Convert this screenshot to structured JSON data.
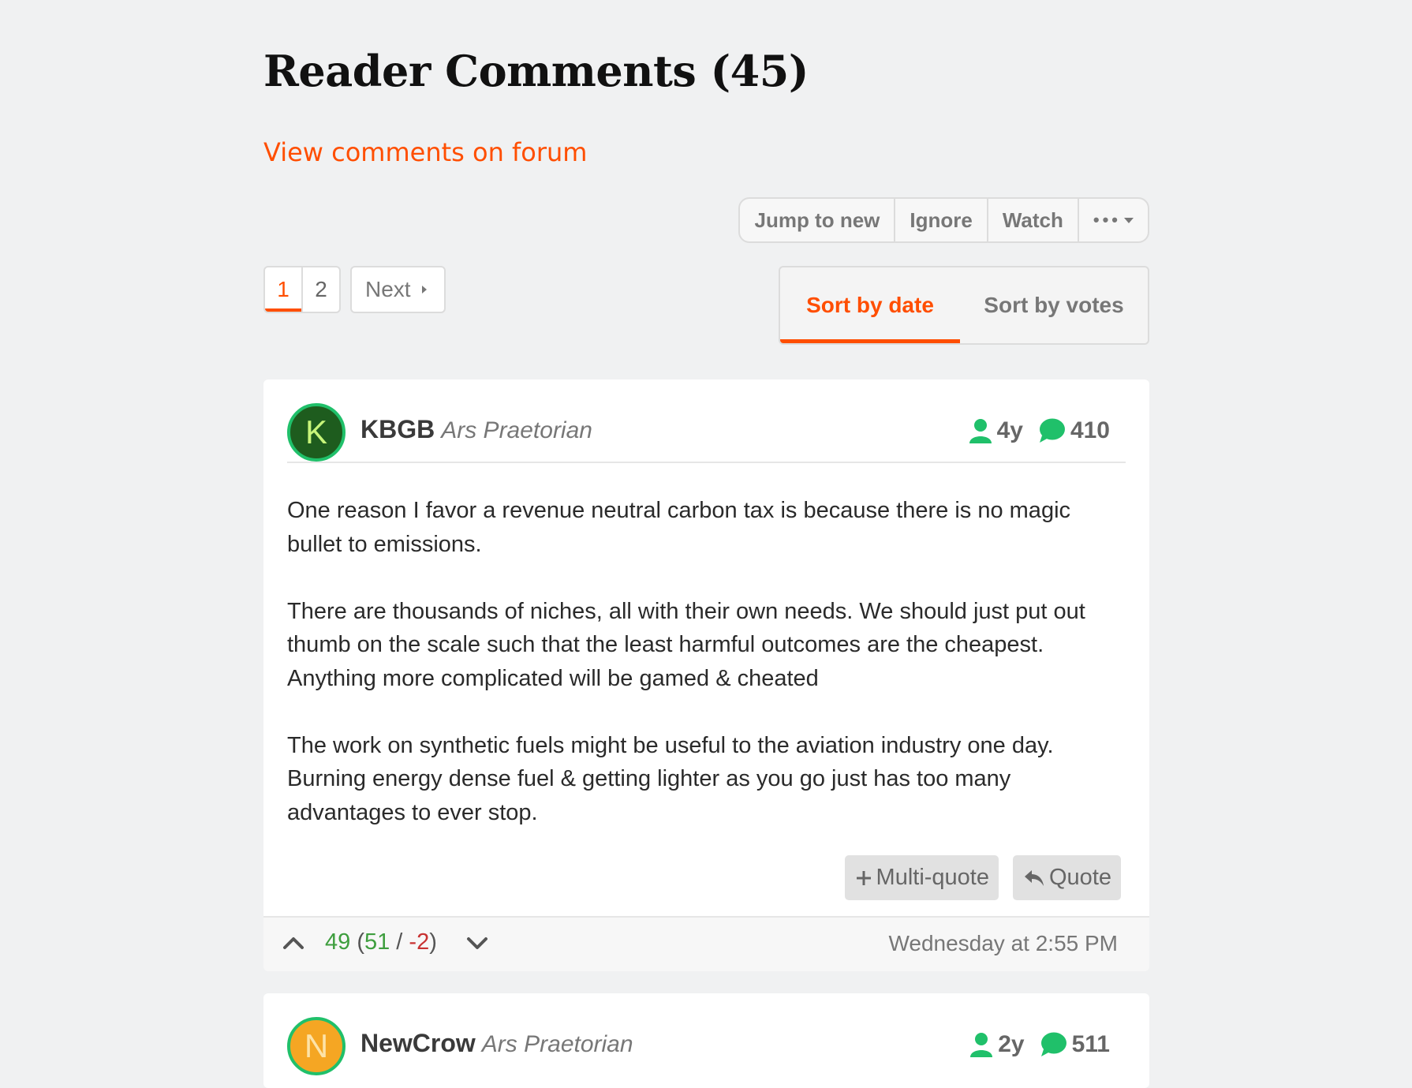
{
  "header": {
    "title": "Reader Comments (45)",
    "forum_link": "View comments on forum"
  },
  "thread_actions": {
    "jump_to_new": "Jump to new",
    "ignore": "Ignore",
    "watch": "Watch",
    "more": "•••"
  },
  "pagination": {
    "pages": [
      "1",
      "2"
    ],
    "current": "1",
    "next_label": "Next"
  },
  "sort": {
    "by_date": "Sort by date",
    "by_votes": "Sort by votes",
    "active": "Sort by date"
  },
  "colors": {
    "accent": "#ff4e00",
    "online_green": "#20c06a",
    "positive": "#3e9e3e",
    "negative": "#c83232"
  },
  "comments": [
    {
      "avatar_letter": "K",
      "username": "KBGB",
      "user_title": "Ars Praetorian",
      "tenure": "4y",
      "post_count": "410",
      "paragraphs": [
        "One reason I favor a revenue neutral carbon tax is because there is no magic bullet to emissions.",
        "There are thousands of niches, all with their own needs. We should just put out thumb on the scale such that the least harmful outcomes are the cheapest. Anything more complicated will be gamed & cheated",
        "The work on synthetic fuels might be useful to the aviation industry one day. Burning energy dense fuel & getting lighter as you go just has too many advantages to ever stop."
      ],
      "multiquote_label": "Multi-quote",
      "quote_label": "Quote",
      "score": "49",
      "upvotes": "51",
      "downvotes": "-2",
      "timestamp": "Wednesday at 2:55 PM"
    },
    {
      "avatar_letter": "N",
      "username": "NewCrow",
      "user_title": "Ars Praetorian",
      "tenure": "2y",
      "post_count": "511"
    }
  ]
}
